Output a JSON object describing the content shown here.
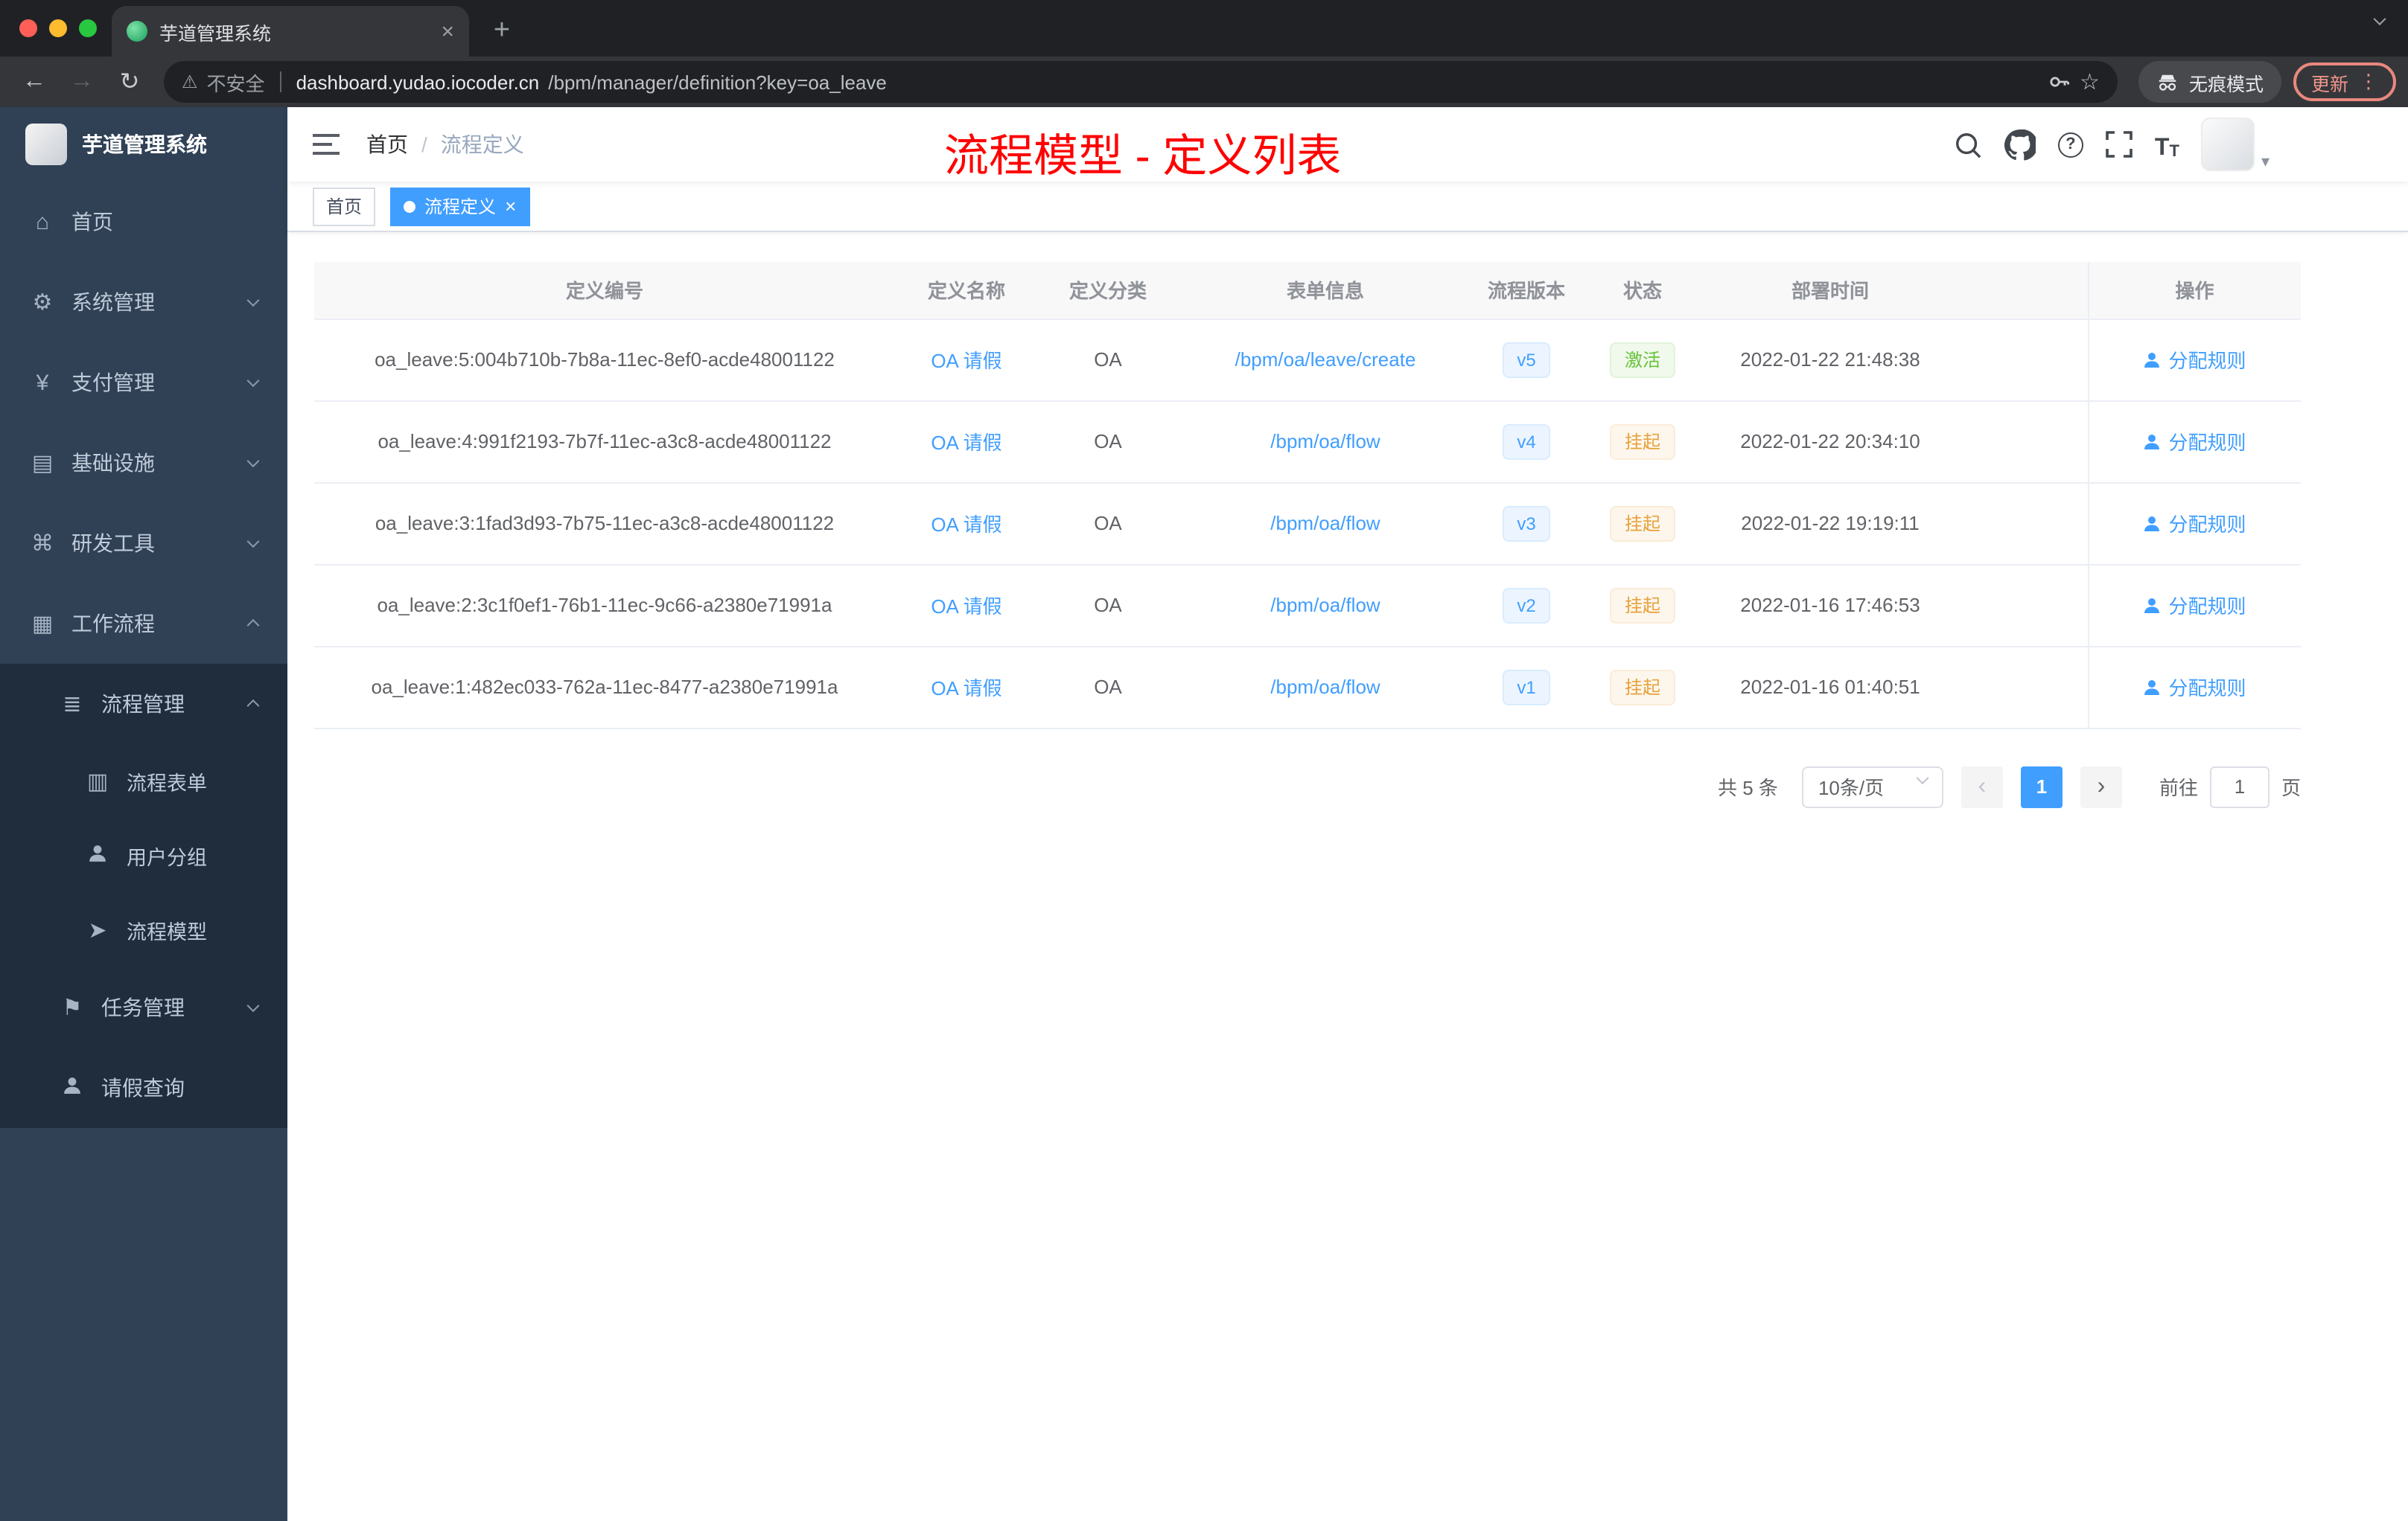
{
  "icons": {
    "plus": "+",
    "close": "×",
    "kebab": "⋮",
    "back": "←",
    "forward": "→",
    "reload": "↻",
    "warning": "⚠",
    "star": "☆",
    "slash": "/",
    "question": "?",
    "caret": "▾",
    "prev": "‹",
    "next": "›",
    "home": "⌂",
    "gear": "⚙",
    "yen": "¥",
    "infra": "▤",
    "tools": "⌘",
    "monitor": "▦",
    "list": "≣",
    "form": "▥",
    "plane": "➤",
    "flag": "⚑",
    "t_large": "T",
    "t_small": "T"
  },
  "browser": {
    "tab_title": "芋道管理系统",
    "security_label": "不安全",
    "url_domain": "dashboard.yudao.iocoder.cn",
    "url_path": "/bpm/manager/definition?key=oa_leave",
    "incognito_label": "无痕模式",
    "update_label": "更新"
  },
  "sidebar": {
    "logo_title": "芋道管理系统",
    "items": [
      {
        "label": "首页"
      },
      {
        "label": "系统管理"
      },
      {
        "label": "支付管理"
      },
      {
        "label": "基础设施"
      },
      {
        "label": "研发工具"
      },
      {
        "label": "工作流程"
      }
    ],
    "process_group": {
      "label": "流程管理"
    },
    "process_children": [
      {
        "label": "流程表单"
      },
      {
        "label": "用户分组"
      },
      {
        "label": "流程模型"
      }
    ],
    "task_group": {
      "label": "任务管理"
    },
    "leave_item": {
      "label": "请假查询"
    }
  },
  "navbar": {
    "breadcrumb": [
      "首页",
      "流程定义"
    ],
    "annotation": "流程模型 - 定义列表"
  },
  "tags": [
    {
      "label": "首页"
    },
    {
      "label": "流程定义"
    }
  ],
  "table": {
    "headers": [
      "定义编号",
      "定义名称",
      "定义分类",
      "表单信息",
      "流程版本",
      "状态",
      "部署时间",
      "操作"
    ],
    "rows": [
      {
        "id": "oa_leave:5:004b710b-7b8a-11ec-8ef0-acde48001122",
        "name": "OA 请假",
        "category": "OA",
        "form": "/bpm/oa/leave/create",
        "version": "v5",
        "status": "激活",
        "status_type": "success",
        "deploy_time": "2022-01-22 21:48:38",
        "action": "分配规则"
      },
      {
        "id": "oa_leave:4:991f2193-7b7f-11ec-a3c8-acde48001122",
        "name": "OA 请假",
        "category": "OA",
        "form": "/bpm/oa/flow",
        "version": "v4",
        "status": "挂起",
        "status_type": "warning",
        "deploy_time": "2022-01-22 20:34:10",
        "action": "分配规则"
      },
      {
        "id": "oa_leave:3:1fad3d93-7b75-11ec-a3c8-acde48001122",
        "name": "OA 请假",
        "category": "OA",
        "form": "/bpm/oa/flow",
        "version": "v3",
        "status": "挂起",
        "status_type": "warning",
        "deploy_time": "2022-01-22 19:19:11",
        "action": "分配规则"
      },
      {
        "id": "oa_leave:2:3c1f0ef1-76b1-11ec-9c66-a2380e71991a",
        "name": "OA 请假",
        "category": "OA",
        "form": "/bpm/oa/flow",
        "version": "v2",
        "status": "挂起",
        "status_type": "warning",
        "deploy_time": "2022-01-16 17:46:53",
        "action": "分配规则"
      },
      {
        "id": "oa_leave:1:482ec033-762a-11ec-8477-a2380e71991a",
        "name": "OA 请假",
        "category": "OA",
        "form": "/bpm/oa/flow",
        "version": "v1",
        "status": "挂起",
        "status_type": "warning",
        "deploy_time": "2022-01-16 01:40:51",
        "action": "分配规则"
      }
    ]
  },
  "pagination": {
    "total": "共 5 条",
    "page_size": "10条/页",
    "current_page": "1",
    "goto_label": "前往",
    "goto_value": "1",
    "page_unit": "页"
  },
  "colors": {
    "accent": "#409EFF",
    "success": "#67C23A",
    "warning": "#E6A23C",
    "annotation": "#FF0000",
    "sidebar_bg": "#304156",
    "submenu_bg": "#1F2D3D"
  }
}
